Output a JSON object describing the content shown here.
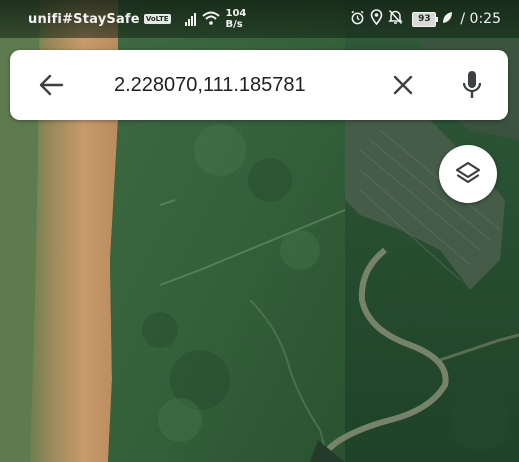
{
  "status_bar": {
    "carrier": "unifi#StaySafe",
    "volte_badge": "VoLTE",
    "net_speed_value": "104",
    "net_speed_unit": "B/s",
    "battery_level": "93",
    "time": "0:25"
  },
  "search": {
    "query": "2.228070,111.185781"
  },
  "icons": {
    "back": "arrow-left-icon",
    "clear": "close-icon",
    "mic": "microphone-icon",
    "layers": "layers-icon",
    "alarm": "alarm-icon",
    "location": "location-pin-icon",
    "mute": "notifications-off-icon",
    "battery_saver": "leaf-icon"
  },
  "colors": {
    "search_background": "#ffffff",
    "icon_color": "#3c4043",
    "text_color": "#202124"
  }
}
